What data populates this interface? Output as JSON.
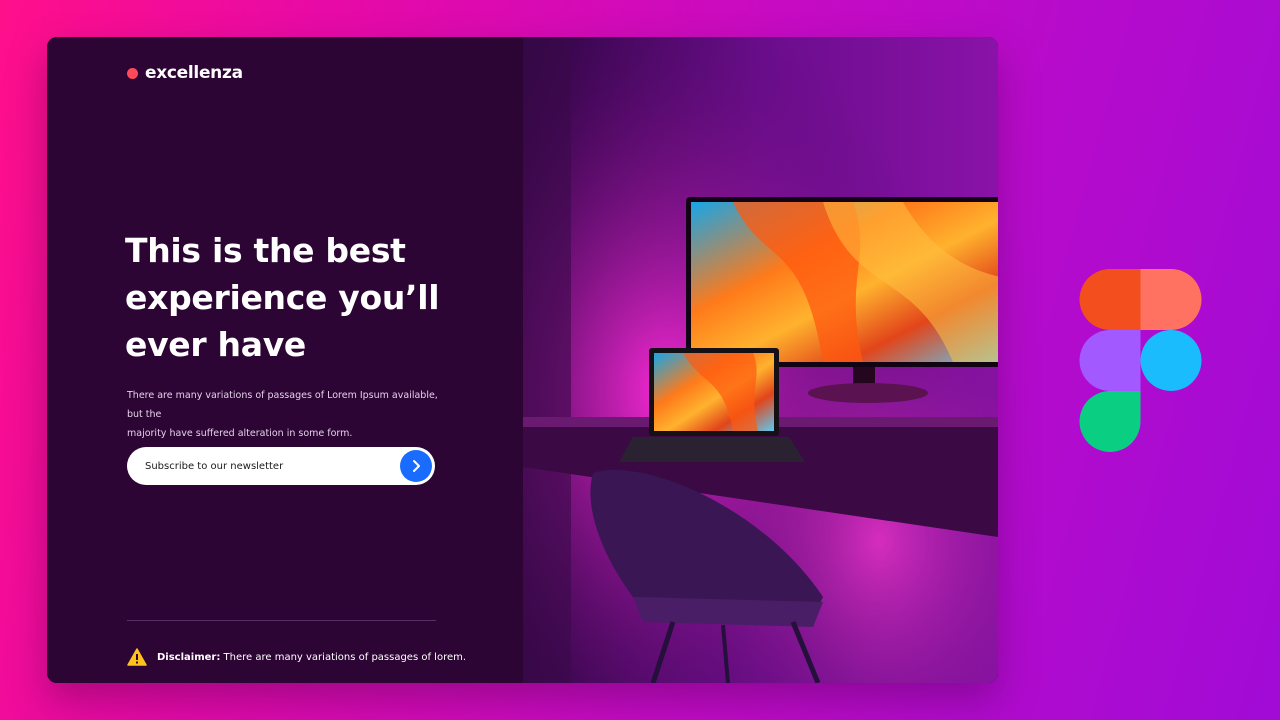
{
  "brand": {
    "name": "excellenza",
    "dot_color": "#ff4a5c"
  },
  "hero": {
    "headline_line1": "This is the best",
    "headline_line2": "experience you’ll",
    "headline_line3": "ever have",
    "subtext_line1": "There are many variations of passages of Lorem Ipsum available, but the",
    "subtext_line2": "majority have suffered alteration in some form."
  },
  "newsletter": {
    "placeholder": "Subscribe to our newsletter",
    "button_color": "#1a6cff",
    "button_icon": "chevron-right-icon"
  },
  "disclaimer": {
    "label": "Disclaimer:",
    "text": " There are many variations of passages of lorem.",
    "icon": "warning-icon"
  },
  "side_logo": {
    "icon": "figma-logo"
  },
  "colors": {
    "background_start": "#ff0f8a",
    "background_end": "#a10bd6",
    "panel": "#2c0534",
    "accent": "#1a6cff"
  }
}
